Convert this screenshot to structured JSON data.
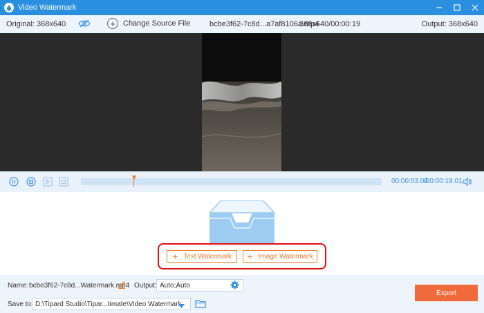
{
  "window": {
    "title": "Video Watermark"
  },
  "info": {
    "original": "Original: 368x640",
    "change_source": "Change Source File",
    "file_name": "bcbe3f62-7c8d...a7af8106a.mp4",
    "file_meta": "368x640/00:00:19",
    "output": "Output: 368x640"
  },
  "player": {
    "current_time": "00:00:03.09",
    "total_time": "/00:00:19.01",
    "progress": 0.174
  },
  "watermark": {
    "text_button": "Text Watermark",
    "image_button": "Image Watermark"
  },
  "bottom": {
    "name_label": "Name:",
    "name_value": "bcbe3f62-7c8d...Watermark.mp4",
    "output_label": "Output:",
    "output_value": "Auto;Auto",
    "save_label": "Save to:",
    "save_path": "D:\\Tipard Studio\\Tipar...timate\\Video Watermark",
    "export_label": "Export"
  },
  "colors": {
    "titlebar": "#2b8fe0",
    "accent_orange": "#f07b28",
    "export": "#f06a3c",
    "highlight": "#e10b12"
  }
}
